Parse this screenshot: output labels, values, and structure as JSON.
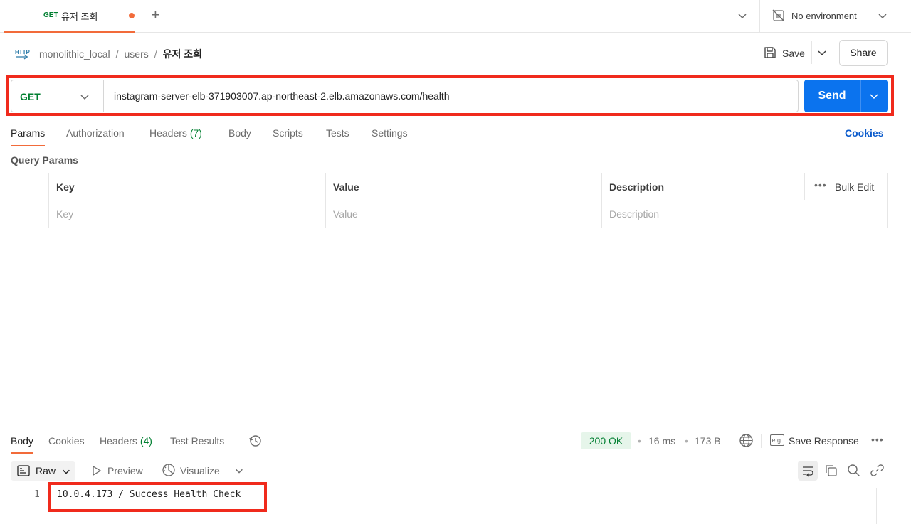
{
  "tab": {
    "method": "GET",
    "title": "유저 조회"
  },
  "environment": {
    "label": "No environment"
  },
  "breadcrumb": {
    "collection": "monolithic_local",
    "folder": "users",
    "request": "유저 조회",
    "separator": "/"
  },
  "toolbar": {
    "save_label": "Save",
    "share_label": "Share"
  },
  "request": {
    "method": "GET",
    "url": "instagram-server-elb-371903007.ap-northeast-2.elb.amazonaws.com/health",
    "send_label": "Send"
  },
  "request_tabs": {
    "params": "Params",
    "authorization": "Authorization",
    "headers": "Headers",
    "headers_count": "(7)",
    "body": "Body",
    "scripts": "Scripts",
    "tests": "Tests",
    "settings": "Settings",
    "cookies": "Cookies"
  },
  "query_params": {
    "title": "Query Params",
    "columns": {
      "key": "Key",
      "value": "Value",
      "description": "Description",
      "bulk_edit": "Bulk Edit",
      "more": "•••"
    },
    "placeholder_row": {
      "key": "Key",
      "value": "Value",
      "description": "Description"
    }
  },
  "response": {
    "tabs": {
      "body": "Body",
      "cookies": "Cookies",
      "headers": "Headers",
      "headers_count": "(4)",
      "test_results": "Test Results"
    },
    "status": "200 OK",
    "time": "16 ms",
    "size": "173 B",
    "meta_dot": "•",
    "save_response": "Save Response",
    "eg_label": "e.g.",
    "more": "•••",
    "format": {
      "raw": "Raw",
      "preview": "Preview",
      "visualize": "Visualize"
    },
    "body_lines": [
      {
        "number": "1",
        "text": "10.0.4.173 / Success Health Check"
      }
    ]
  },
  "colors": {
    "accent": "#f26b3a",
    "primary": "#0b73ee",
    "method_get": "#007f31",
    "highlight": "#f02a1c"
  }
}
